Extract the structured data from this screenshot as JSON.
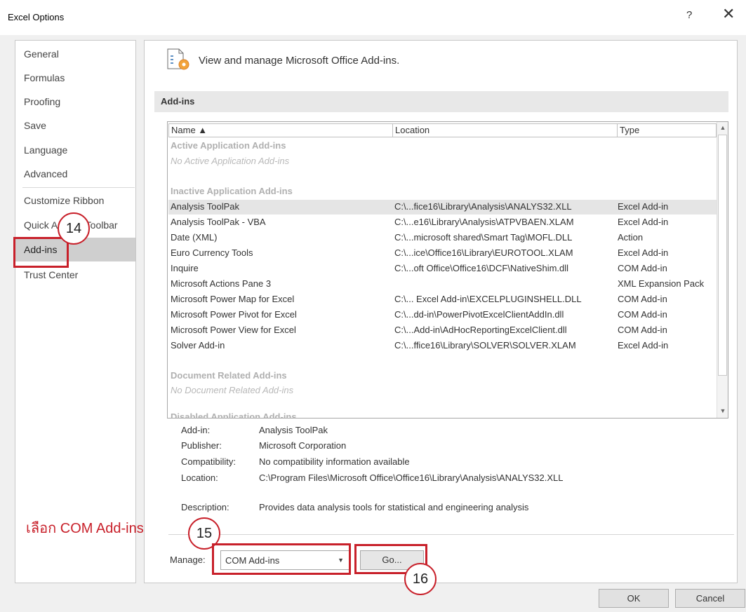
{
  "window": {
    "title": "Excel Options",
    "help_label": "?",
    "close_label": "✕"
  },
  "sidebar": {
    "items": [
      {
        "label": "General"
      },
      {
        "label": "Formulas"
      },
      {
        "label": "Proofing"
      },
      {
        "label": "Save"
      },
      {
        "label": "Language"
      },
      {
        "label": "Advanced"
      },
      {
        "label": "Customize Ribbon"
      },
      {
        "label": "Quick Access Toolbar"
      },
      {
        "label": "Add-ins",
        "selected": true
      },
      {
        "label": "Trust Center"
      }
    ]
  },
  "main": {
    "header_text": "View and manage Microsoft Office Add-ins.",
    "header_icon": "addins-gear-icon",
    "section_title": "Add-ins",
    "columns": {
      "name": "Name ▲",
      "location": "Location",
      "type": "Type"
    },
    "groups": {
      "active_title": "Active Application Add-ins",
      "active_empty": "No Active Application Add-ins",
      "inactive_title": "Inactive Application Add-ins",
      "document_title": "Document Related Add-ins",
      "document_empty": "No Document Related Add-ins",
      "disabled_title": "Disabled Application Add-ins"
    },
    "rows": [
      {
        "name": "Analysis ToolPak",
        "location": "C:\\...fice16\\Library\\Analysis\\ANALYS32.XLL",
        "type": "Excel Add-in",
        "selected": true
      },
      {
        "name": "Analysis ToolPak - VBA",
        "location": "C:\\...e16\\Library\\Analysis\\ATPVBAEN.XLAM",
        "type": "Excel Add-in"
      },
      {
        "name": "Date (XML)",
        "location": "C:\\...microsoft shared\\Smart Tag\\MOFL.DLL",
        "type": "Action"
      },
      {
        "name": "Euro Currency Tools",
        "location": "C:\\...ice\\Office16\\Library\\EUROTOOL.XLAM",
        "type": "Excel Add-in"
      },
      {
        "name": "Inquire",
        "location": "C:\\...oft Office\\Office16\\DCF\\NativeShim.dll",
        "type": "COM Add-in"
      },
      {
        "name": "Microsoft Actions Pane 3",
        "location": "",
        "type": "XML Expansion Pack"
      },
      {
        "name": "Microsoft Power Map for Excel",
        "location": "C:\\... Excel Add-in\\EXCELPLUGINSHELL.DLL",
        "type": "COM Add-in"
      },
      {
        "name": "Microsoft Power Pivot for Excel",
        "location": "C:\\...dd-in\\PowerPivotExcelClientAddIn.dll",
        "type": "COM Add-in"
      },
      {
        "name": "Microsoft Power View for Excel",
        "location": "C:\\...Add-in\\AdHocReportingExcelClient.dll",
        "type": "COM Add-in"
      },
      {
        "name": "Solver Add-in",
        "location": "C:\\...ffice16\\Library\\SOLVER\\SOLVER.XLAM",
        "type": "Excel Add-in"
      }
    ],
    "details": {
      "addin_label": "Add-in:",
      "addin_value": "Analysis ToolPak",
      "publisher_label": "Publisher:",
      "publisher_value": "Microsoft Corporation",
      "compat_label": "Compatibility:",
      "compat_value": "No compatibility information available",
      "location_label": "Location:",
      "location_value": "C:\\Program Files\\Microsoft Office\\Office16\\Library\\Analysis\\ANALYS32.XLL",
      "description_label": "Description:",
      "description_value": "Provides data analysis tools for statistical and engineering analysis"
    },
    "manage": {
      "label": "Manage:",
      "selected": "COM Add-ins",
      "go_label": "Go..."
    }
  },
  "footer": {
    "ok_label": "OK",
    "cancel_label": "Cancel"
  },
  "annotations": {
    "step14": "14",
    "step15": "15",
    "step16": "16",
    "note": "เลือก COM Add-ins",
    "color": "#c8202a"
  }
}
